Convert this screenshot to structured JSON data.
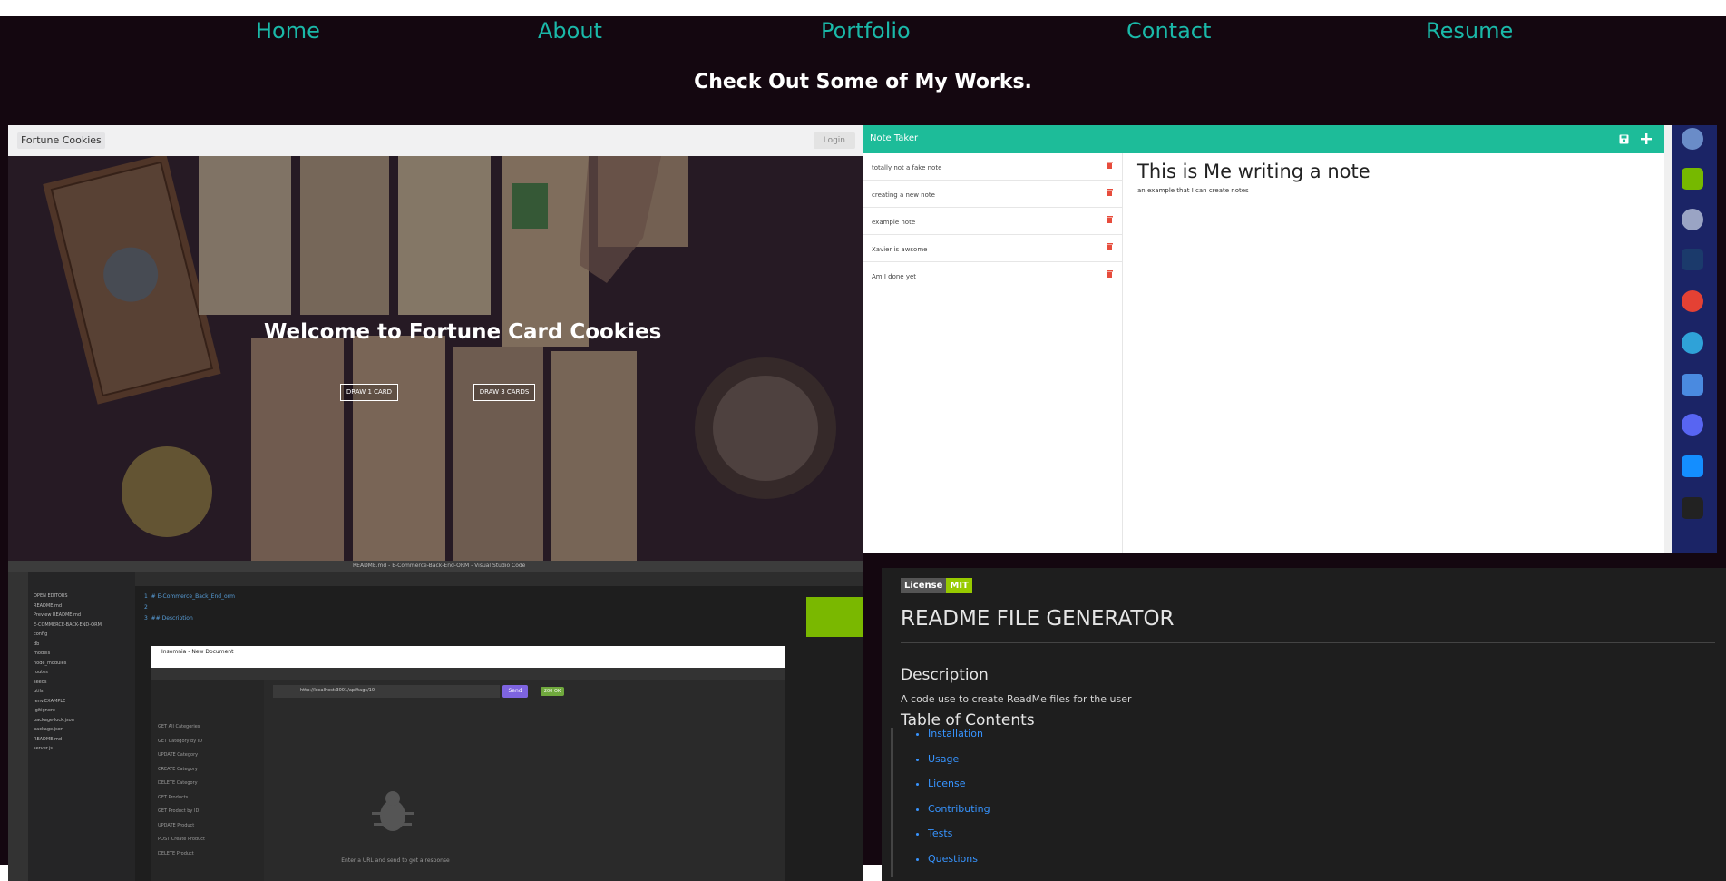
{
  "nav": [
    "Home",
    "About",
    "Portfolio",
    "Contact",
    "Resume"
  ],
  "heading": "Check Out Some of My Works.",
  "fortune": {
    "brand": "Fortune Cookies",
    "login": "Login",
    "title": "Welcome to Fortune Card Cookies",
    "btn1": "DRAW 1 CARD",
    "btn2": "DRAW 3 CARDS"
  },
  "notes": {
    "app_title": "Note Taker",
    "items": [
      "totally not a fake note",
      "creating a new note",
      "example note",
      "Xavier is awsome",
      "Am I done yet"
    ],
    "note_title": "This is Me writing a note",
    "note_text": "an example that I can create notes"
  },
  "vscode": {
    "title": "README.md - E-Commerce-Back-End-ORM - Visual Studio Code",
    "insomnia_title": "Insomnia - New Document",
    "url": "http://localhost:3001/api/tags/10",
    "send": "Send",
    "status": "200 OK",
    "empty_hint": "Enter a URL and send to get a response",
    "explorer": [
      "OPEN EDITORS",
      "README.md",
      "Preview README.md",
      "E-COMMERCE-BACK-END-ORM",
      "config",
      "db",
      "models",
      "node_modules",
      "routes",
      "seeds",
      "utils",
      ".env.EXAMPLE",
      ".gitignore",
      "package-lock.json",
      "package.json",
      "README.md",
      "server.js"
    ],
    "routes": [
      "GET All Categories",
      "GET Category by ID",
      "UPDATE Category",
      "CREATE Category",
      "DELETE Category",
      "GET Products",
      "GET Product by ID",
      "UPDATE Product",
      "POST Create Product",
      "DELETE Product"
    ]
  },
  "readme": {
    "badge_left": "License",
    "badge_right": "MIT",
    "title": "README FILE GENERATOR",
    "description_heading": "Description",
    "description": "A code use to create ReadMe files for the user",
    "toc_heading": "Table of Contents",
    "toc": [
      "Installation",
      "Usage",
      "License",
      "Contributing",
      "Tests",
      "Questions"
    ]
  },
  "colors": {
    "nav": "#1ab8a8",
    "bg": "#140710",
    "notes_header": "#1dbc99",
    "link": "#3794ff",
    "badge": "#97ca00"
  }
}
